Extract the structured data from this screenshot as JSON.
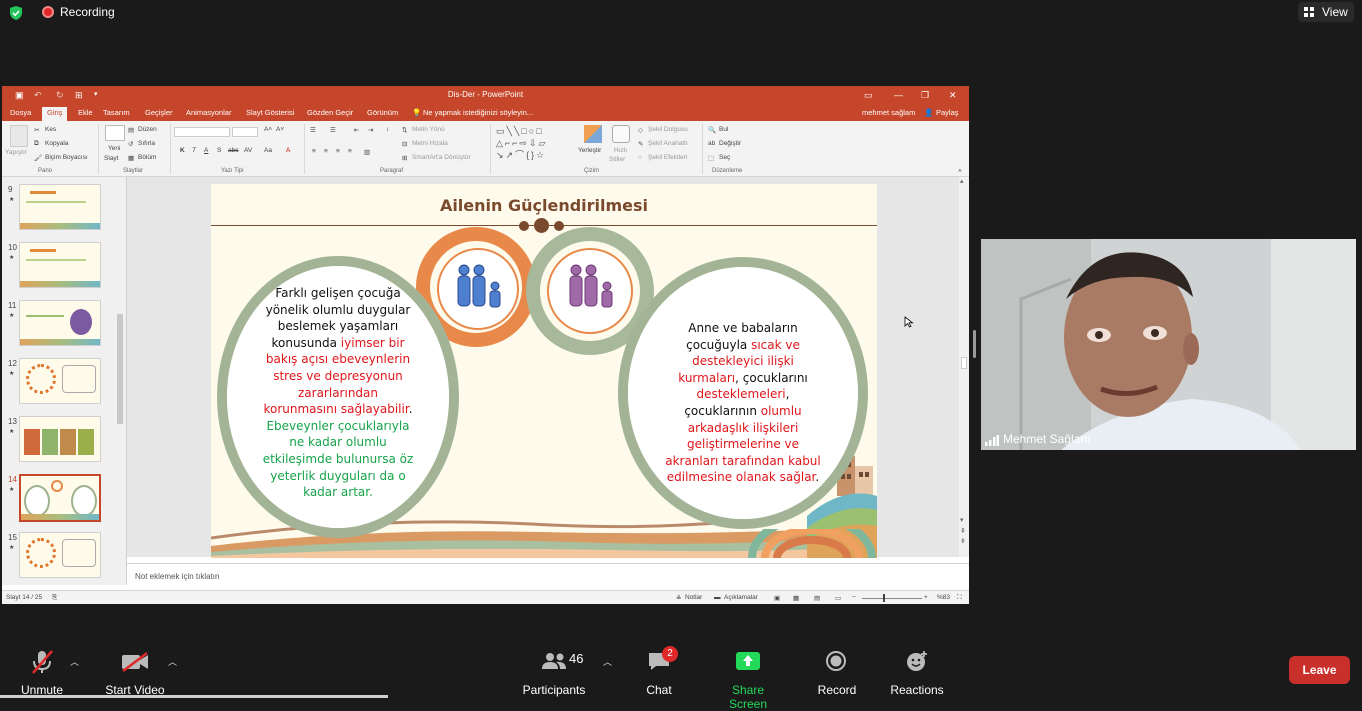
{
  "zoom": {
    "recording_label": "Recording",
    "view_label": "View",
    "participant_name": "Mehmet Sağlam",
    "toolbar": {
      "unmute": "Unmute",
      "start_video": "Start Video",
      "participants": "Participants",
      "participants_count": "46",
      "chat": "Chat",
      "chat_badge": "2",
      "share_screen": "Share Screen",
      "record": "Record",
      "reactions": "Reactions",
      "leave": "Leave"
    },
    "colors": {
      "share_green": "#23d959",
      "leave_red": "#c9302c",
      "recording_red": "#e02828"
    }
  },
  "ppt": {
    "window_title": "Dis-Der - PowerPoint",
    "tabs": [
      "Dosya",
      "Giriş",
      "Ekle",
      "Tasarım",
      "Geçişler",
      "Animasyonlar",
      "Slayt Gösterisi",
      "Gözden Geçir",
      "Görünüm"
    ],
    "tell_me": "Ne yapmak istediğinizi söyleyin...",
    "user": "mehmet sağlam",
    "share": "Paylaş",
    "ribbon": {
      "pano": {
        "group": "Pano",
        "paste": "Yapıştır",
        "cut": "Kes",
        "copy": "Kopyala",
        "format_painter": "Biçim Boyacısı"
      },
      "slaytlar": {
        "group": "Slaytlar",
        "new_slide_1": "Yeni",
        "new_slide_2": "Slayt",
        "layout": "Düzen",
        "reset": "Sıfırla",
        "section": "Bölüm"
      },
      "yazi_tipi": {
        "group": "Yazı Tipi",
        "bold": "K",
        "italic": "T",
        "underline": "A",
        "strike": "S",
        "abc": "abc",
        "av": "AV",
        "aa": "Aa",
        "a": "A"
      },
      "paragraf": {
        "group": "Paragraf",
        "text_direction": "Metin Yönü",
        "align_text": "Metni Hizala",
        "smartart": "SmartArt'a Dönüştür"
      },
      "cizim": {
        "group": "Çizim",
        "arrange": "Yerleştir",
        "quick_styles_1": "Hızlı",
        "quick_styles_2": "Stiller",
        "fill": "Şekil Dolgusu",
        "outline": "Şekil Anahattı",
        "effects": "Şekil Efektleri"
      },
      "duzenleme": {
        "group": "Düzenleme",
        "find": "Bul",
        "replace": "Değiştir",
        "select": "Seç"
      }
    },
    "thumbnails": [
      {
        "num": "9",
        "star": "★"
      },
      {
        "num": "10",
        "star": "★"
      },
      {
        "num": "11",
        "star": "★"
      },
      {
        "num": "12",
        "star": "★"
      },
      {
        "num": "13",
        "star": "★"
      },
      {
        "num": "14",
        "star": "★"
      },
      {
        "num": "15",
        "star": "★"
      }
    ],
    "slide": {
      "title": "Ailenin Güçlendirilmesi",
      "left_text": [
        {
          "t": "Farklı gelişen çocuğa",
          "c": "black"
        },
        {
          "t": "yönelik olumlu duygular",
          "c": "black"
        },
        {
          "t": "beslemek yaşamları",
          "c": "black"
        },
        {
          "t": "konusunda ",
          "c": "black",
          "t2": "iyimser bir"
        },
        {
          "t": "bakış açısı ebeveynlerin",
          "c": "red"
        },
        {
          "t": "stres ve depresyonun",
          "c": "red"
        },
        {
          "t": "zararlarından",
          "c": "red"
        },
        {
          "t": "korunmasını sağlayabilir",
          "c": "red",
          "t2": "."
        },
        {
          "t": "Ebeveynler çocuklarıyla",
          "c": "green"
        },
        {
          "t": "ne kadar olumlu",
          "c": "green"
        },
        {
          "t": "etkileşimde bulunursa öz",
          "c": "green"
        },
        {
          "t": "yeterlik duyguları da o",
          "c": "green"
        },
        {
          "t": "kadar artar.",
          "c": "green"
        }
      ],
      "right_text": [
        {
          "t": "Anne ve babaların",
          "c": "black"
        },
        {
          "t": "çocuğuyla ",
          "c": "black",
          "t2": "sıcak ve"
        },
        {
          "t": "destekleyici ilişki",
          "c": "red"
        },
        {
          "t": "kurmaları",
          "c": "red",
          "t2": ", çocuklarını"
        },
        {
          "t": "desteklemeleri",
          "c": "red",
          "t2": ","
        },
        {
          "t": "çocuklarının ",
          "c": "black",
          "t2": "olumlu"
        },
        {
          "t": "arkadaşlık ilişkileri",
          "c": "red"
        },
        {
          "t": "geliştirmelerine ve",
          "c": "red"
        },
        {
          "t": "akranları tarafından kabul",
          "c": "red"
        },
        {
          "t": "edilmesine olanak sağlar",
          "c": "red",
          "t2": "."
        }
      ]
    },
    "notes_placeholder": "Not eklemek için tıklatın",
    "status": {
      "slide_counter": "Slayt 14 / 25",
      "notes": "Notlar",
      "comments": "Açıklamalar",
      "zoom": "%83"
    }
  }
}
